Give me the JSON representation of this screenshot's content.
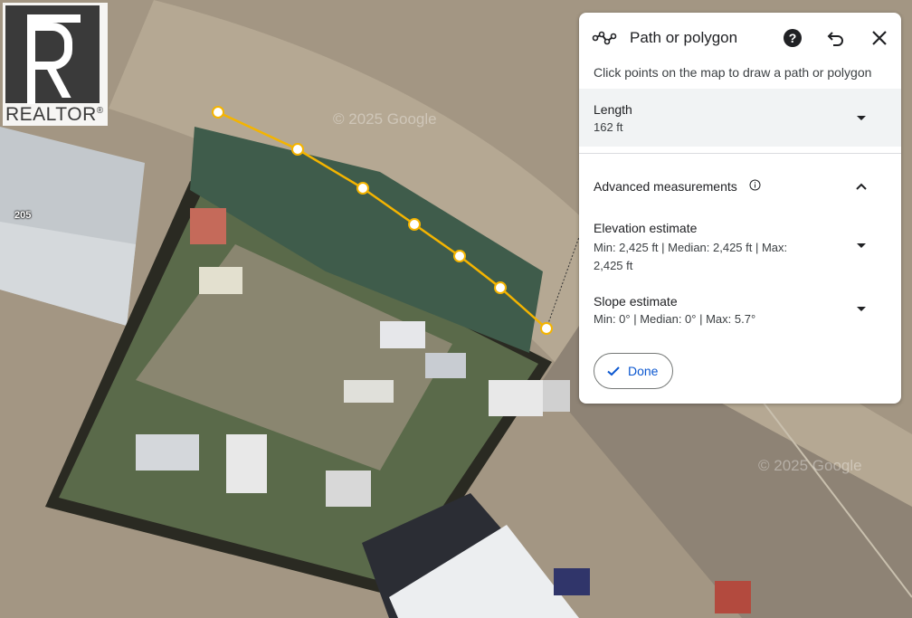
{
  "map": {
    "road_label": "205",
    "watermark": "© 2025 Google"
  },
  "logo": {
    "word": "REALTOR",
    "mark": "®"
  },
  "panel": {
    "title": "Path or polygon",
    "instruction": "Click points on the map to draw a path or polygon",
    "icons": [
      "path-icon",
      "help-icon",
      "undo-icon",
      "close-icon"
    ],
    "length": {
      "label": "Length",
      "value": "162 ft"
    },
    "advanced": {
      "label": "Advanced measurements",
      "elevation": {
        "label": "Elevation estimate",
        "value": "Min: 2,425 ft | Median: 2,425 ft | Max: 2,425 ft"
      },
      "slope": {
        "label": "Slope estimate",
        "value": "Min: 0° | Median: 0° | Max: 5.7°"
      }
    },
    "done_label": "Done"
  },
  "colors": {
    "path_line": "#f4b400",
    "accent": "#0b57d0"
  }
}
